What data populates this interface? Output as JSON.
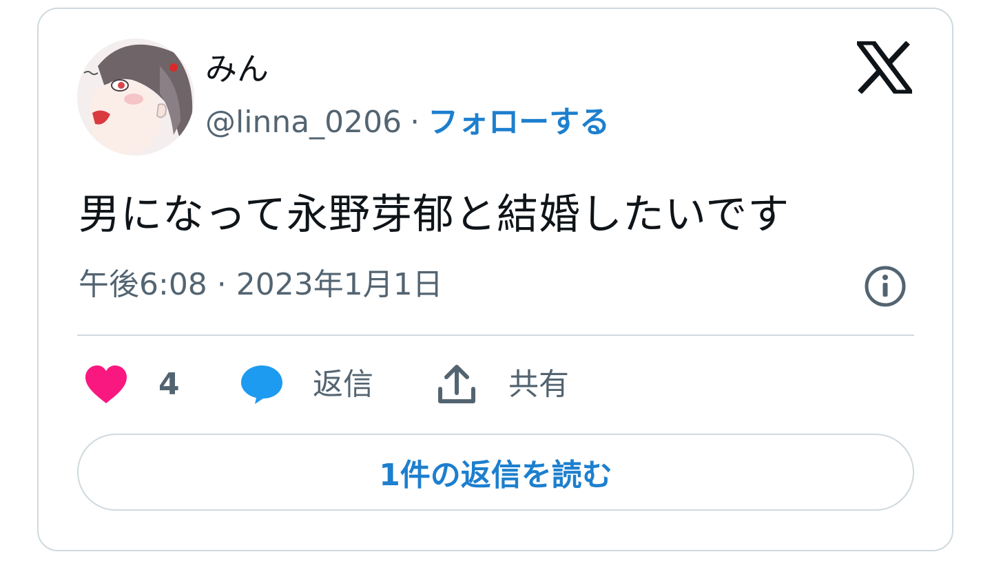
{
  "author": {
    "display_name": "みん",
    "handle": "@linna_0206",
    "separator": "·",
    "follow_label": "フォローする",
    "avatar_icon": "avatar-illustration"
  },
  "tweet": {
    "text": "男になって永野芽郁と結婚したいです",
    "timestamp": "午後6:08 · 2023年1月1日"
  },
  "actions": {
    "like_count": "4",
    "reply_label": "返信",
    "share_label": "共有"
  },
  "footer": {
    "read_replies_label": "1件の返信を読む"
  },
  "icons": {
    "brand": "x-logo-icon",
    "info": "info-icon",
    "like": "heart-icon",
    "reply": "speech-bubble-icon",
    "share": "share-upload-icon"
  },
  "colors": {
    "link_blue": "#1d7fce",
    "like_pink": "#f91880",
    "reply_blue": "#1d9bf0",
    "secondary_text": "#536471",
    "border": "#cfd9de"
  }
}
